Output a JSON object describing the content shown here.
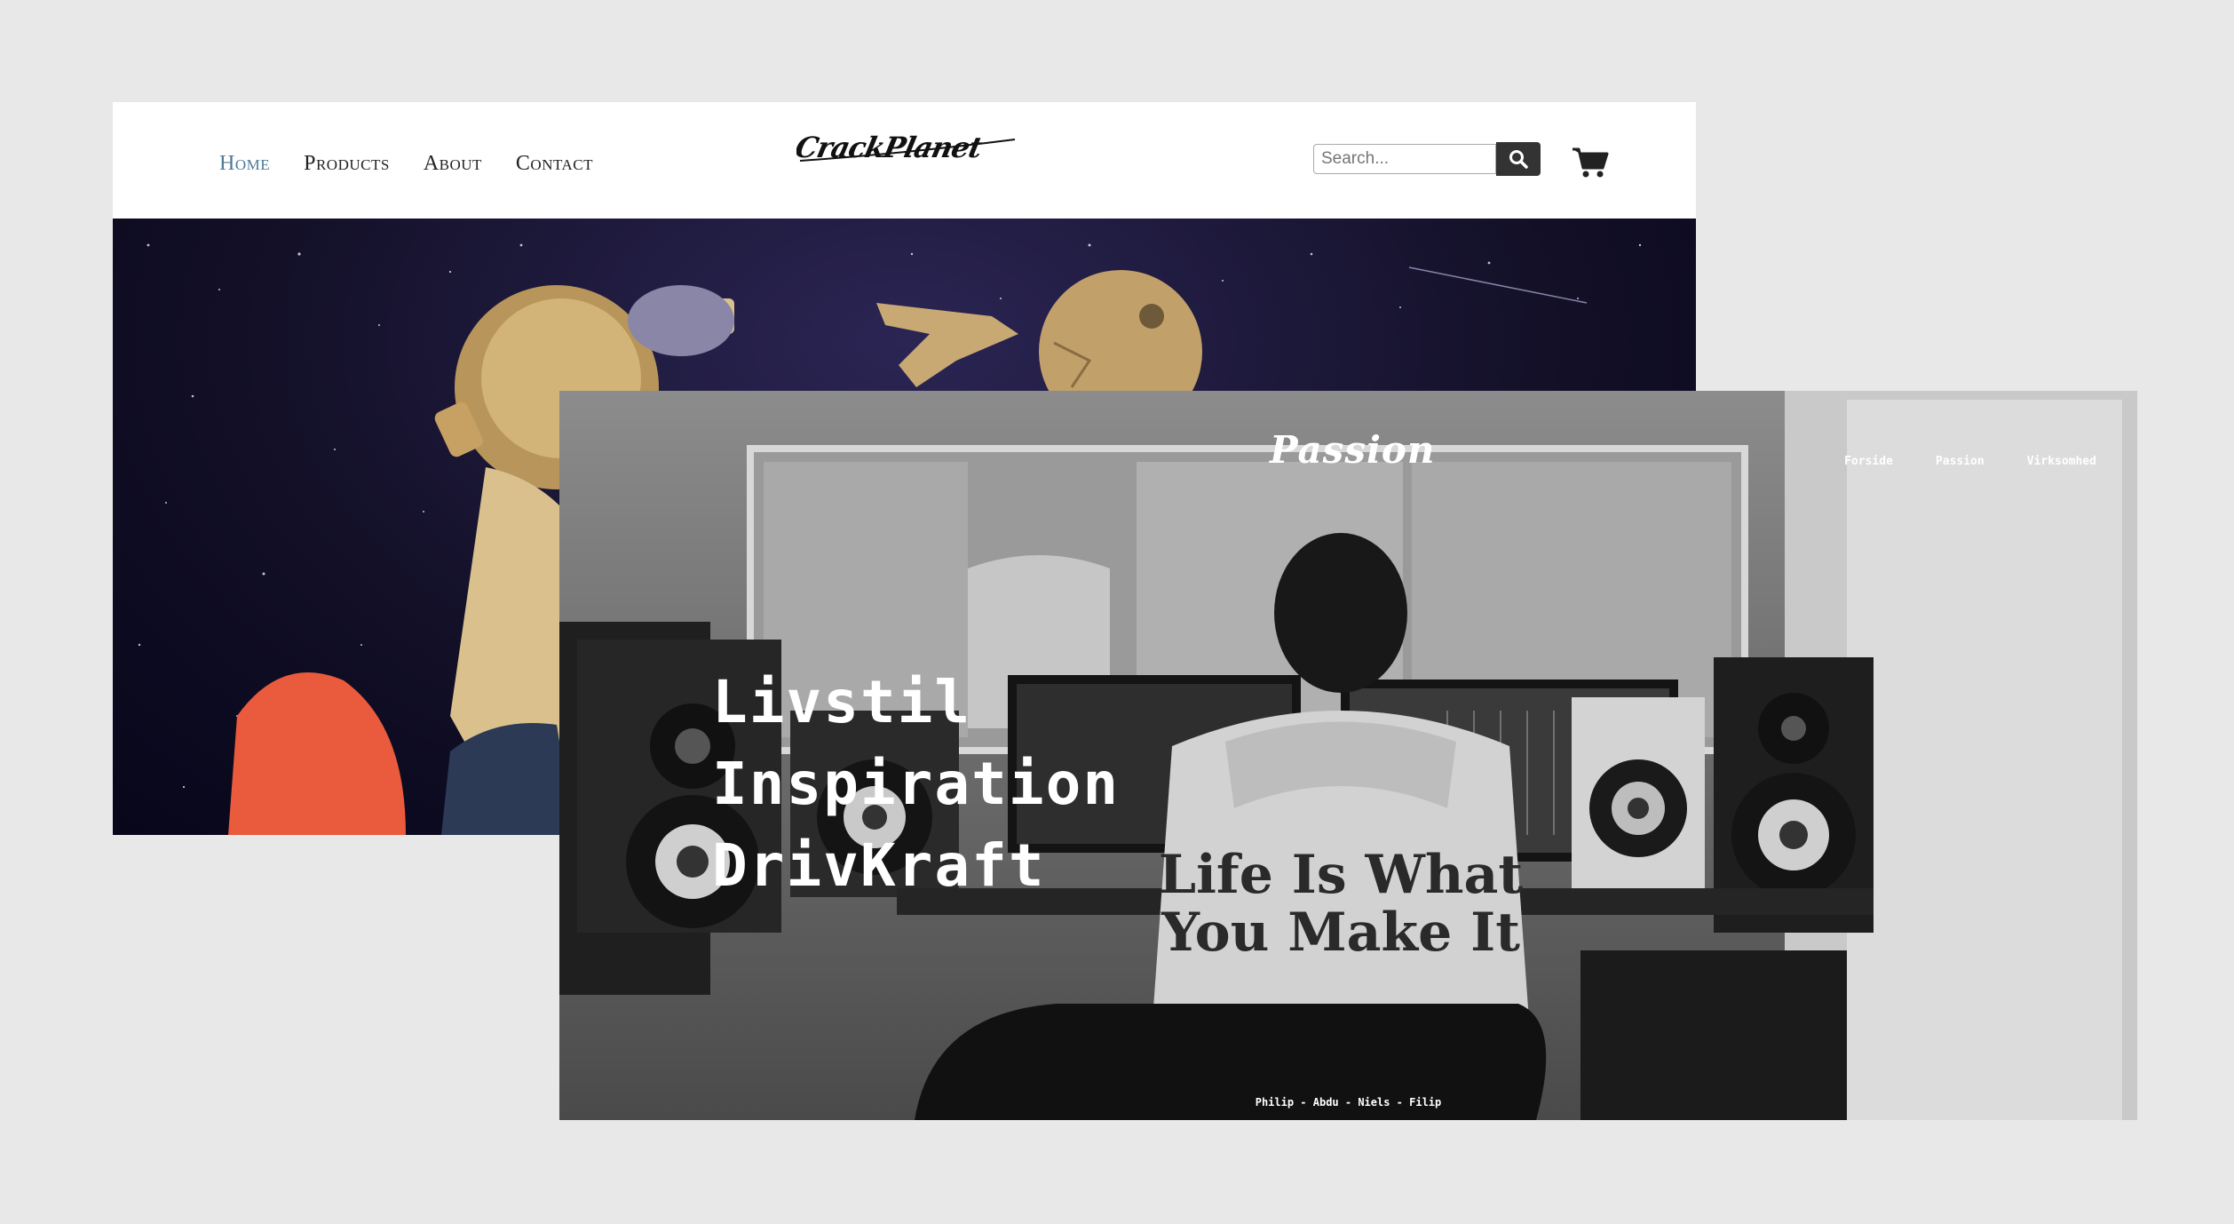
{
  "site_a": {
    "nav": [
      "Home",
      "Products",
      "About",
      "Contact"
    ],
    "active_nav": "Home",
    "logo_text": "CrackPlanet",
    "search": {
      "placeholder": "Search..."
    },
    "colors": {
      "active_link": "#4d7a99",
      "search_button": "#333333"
    }
  },
  "site_b": {
    "brand": "Passion",
    "menu": [
      "Forside",
      "Passion",
      "Virksomhed"
    ],
    "headline": [
      "Livstil",
      "Inspiration",
      "DrivKraft"
    ],
    "credits": "Philip - Abdu - Niels - Filip",
    "hoodie_text": [
      "Life Is What",
      "You Make It"
    ]
  }
}
